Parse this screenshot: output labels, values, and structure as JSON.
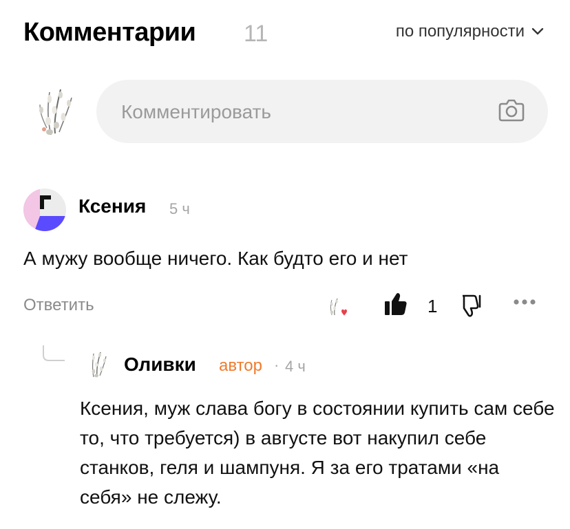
{
  "header": {
    "title": "Комментарии",
    "count": "11",
    "sort_label": "по популярности",
    "sort_icon": "chevron-down-icon"
  },
  "composer": {
    "placeholder": "Комментировать",
    "avatar": "willow-branches-avatar",
    "attach_icon": "camera-icon"
  },
  "comment": {
    "author": "Ксения",
    "time": "5 ч",
    "text": "А мужу вообще ничего. Как будто его и нет",
    "reply_label": "Ответить",
    "likes": "1",
    "author_reaction_icon": "author-heart-icon",
    "colors": {
      "avatar_pink": "#f2c6e4",
      "avatar_purple": "#5b4bff",
      "avatar_black": "#111111"
    }
  },
  "reply": {
    "author": "Оливки",
    "badge": "автор",
    "separator": "·",
    "time": "4 ч",
    "text": "Ксения, муж слава богу в состоянии купить сам себе то, что требуется) в августе вот накупил себе станков, геля и шампуня. Я за его тратами «на себя» не слежу.",
    "badge_color": "#f07a2c"
  }
}
